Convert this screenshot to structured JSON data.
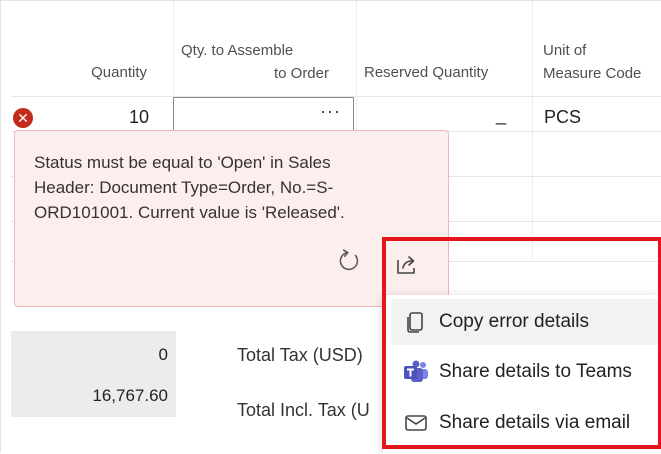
{
  "columns": {
    "quantity": "Quantity",
    "qty_assemble_line1": "Qty. to Assemble",
    "qty_assemble_line2": "to Order",
    "reserved_quantity": "Reserved Quantity",
    "uom_line1": "Unit of",
    "uom_line2": "Measure Code"
  },
  "line": {
    "error_indicator": "✕",
    "quantity": "10",
    "assemble_placeholder": "···",
    "reserved": "_",
    "uom": "PCS"
  },
  "error": {
    "message": "Status must be equal to 'Open' in Sales Header: Document Type=Order, No.=S-ORD101001. Current value is 'Released'."
  },
  "totals": {
    "value1": "0",
    "value2": "16,767.60",
    "tax_label": "Total Tax (USD)",
    "incl_tax_label": "Total Incl. Tax (U"
  },
  "menu": {
    "items": [
      {
        "label": "Copy error details",
        "icon": "copy-icon"
      },
      {
        "label": "Share details to Teams",
        "icon": "teams-icon"
      },
      {
        "label": "Share details via email",
        "icon": "email-icon"
      }
    ]
  },
  "colors": {
    "error_red": "#c42b1c",
    "popup_bg": "#fdeeee",
    "highlight": "#e3151d",
    "teams_purple": "#5b5fc7"
  }
}
